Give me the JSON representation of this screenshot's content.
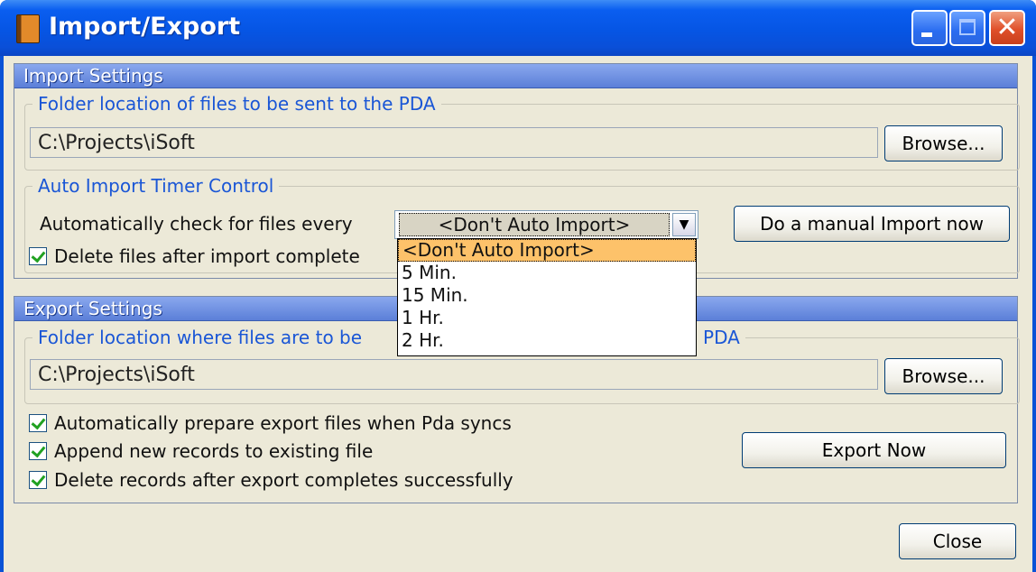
{
  "window": {
    "title": "Import/Export"
  },
  "import": {
    "header": "Import Settings",
    "folder_legend": "Folder location of files to be sent to the PDA",
    "folder_path": "C:\\Projects\\iSoft",
    "browse_label": "Browse...",
    "timer_legend": "Auto Import Timer Control",
    "check_label": "Automatically check for files every",
    "interval_selected": "<Don't Auto Import>",
    "interval_options": [
      "<Don't Auto Import>",
      "5 Min.",
      "15 Min.",
      "1 Hr.",
      "2 Hr."
    ],
    "manual_import_label": "Do a manual Import now",
    "delete_after_label": "Delete files after import complete",
    "delete_after_checked": true
  },
  "export": {
    "header": "Export Settings",
    "folder_legend_left": "Folder location where files are to be",
    "folder_legend_right": "PDA",
    "folder_path": "C:\\Projects\\iSoft",
    "browse_label": "Browse...",
    "options": [
      {
        "label": "Automatically prepare export files when Pda syncs",
        "checked": true
      },
      {
        "label": "Append new records to existing file",
        "checked": true
      },
      {
        "label": "Delete records after export completes successfully",
        "checked": true
      }
    ],
    "export_now_label": "Export Now"
  },
  "close_label": "Close",
  "colors": {
    "title_bar": "#0a5ef0",
    "dropdown_highlight": "#fdc26a",
    "checkmark": "#21a121"
  }
}
